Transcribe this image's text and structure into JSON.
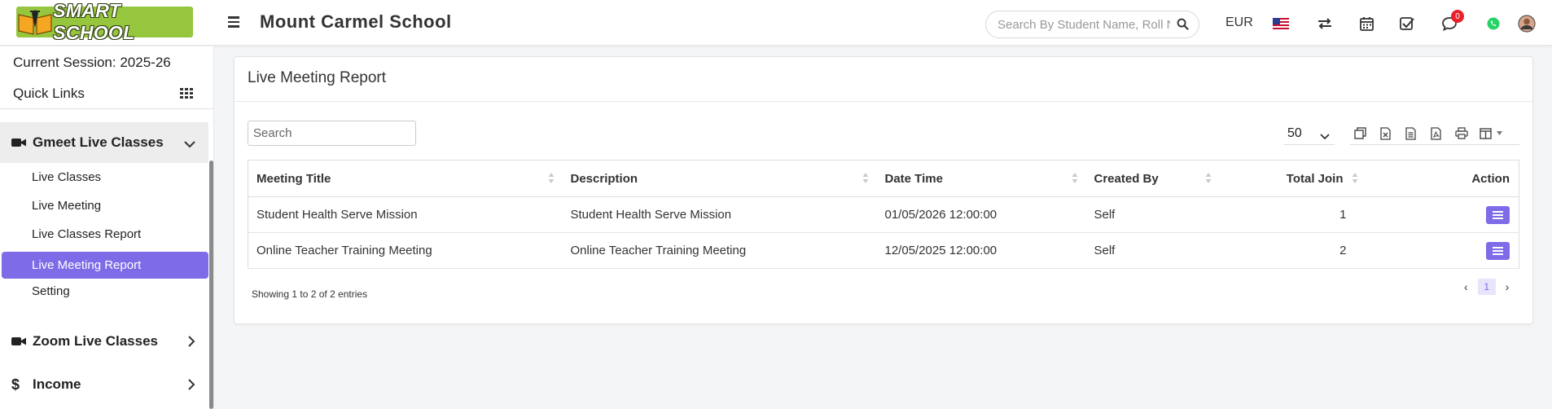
{
  "app": {
    "logo_text": "SMART SCHOOL",
    "school_name": "Mount Carmel School",
    "search_placeholder": "Search By Student Name, Roll Number, Enroll Number, National Id, Local Id Etc.",
    "currency": "EUR",
    "notification_count": "0",
    "accent_color": "#7d6be8",
    "logo_color": "#95c63d"
  },
  "sidebar": {
    "current_session": "Current Session: 2025-26",
    "quick_links": "Quick Links",
    "groups": [
      {
        "label": "Gmeet Live Classes",
        "icon": "video-camera-icon",
        "expanded": true
      },
      {
        "label": "Zoom Live Classes",
        "icon": "video-camera-icon",
        "expanded": false
      },
      {
        "label": "Income",
        "icon": "dollar-icon",
        "expanded": false
      }
    ],
    "items": [
      {
        "label": "Live Classes"
      },
      {
        "label": "Live Meeting"
      },
      {
        "label": "Live Classes Report"
      },
      {
        "label": "Live Meeting Report",
        "active": true
      },
      {
        "label": "Setting"
      }
    ]
  },
  "main": {
    "title": "Live Meeting Report",
    "search_placeholder": "Search",
    "page_size": "50",
    "columns": [
      "Meeting Title",
      "Description",
      "Date Time",
      "Created By",
      "Total Join",
      "Action"
    ],
    "rows": [
      {
        "title": "Student Health Serve Mission",
        "description": "Student Health Serve Mission",
        "datetime": "01/05/2026 12:00:00",
        "created_by": "Self",
        "total_join": "1"
      },
      {
        "title": "Online Teacher Training Meeting",
        "description": "Online Teacher Training Meeting",
        "datetime": "12/05/2025 12:00:00",
        "created_by": "Self",
        "total_join": "2"
      }
    ],
    "info": "Showing 1 to 2 of 2 entries",
    "pagination": {
      "prev": "‹",
      "current": "1",
      "next": "›"
    },
    "export_icons": [
      "copy-icon",
      "excel-icon",
      "csv-icon",
      "pdf-icon",
      "print-icon",
      "columns-icon"
    ]
  }
}
